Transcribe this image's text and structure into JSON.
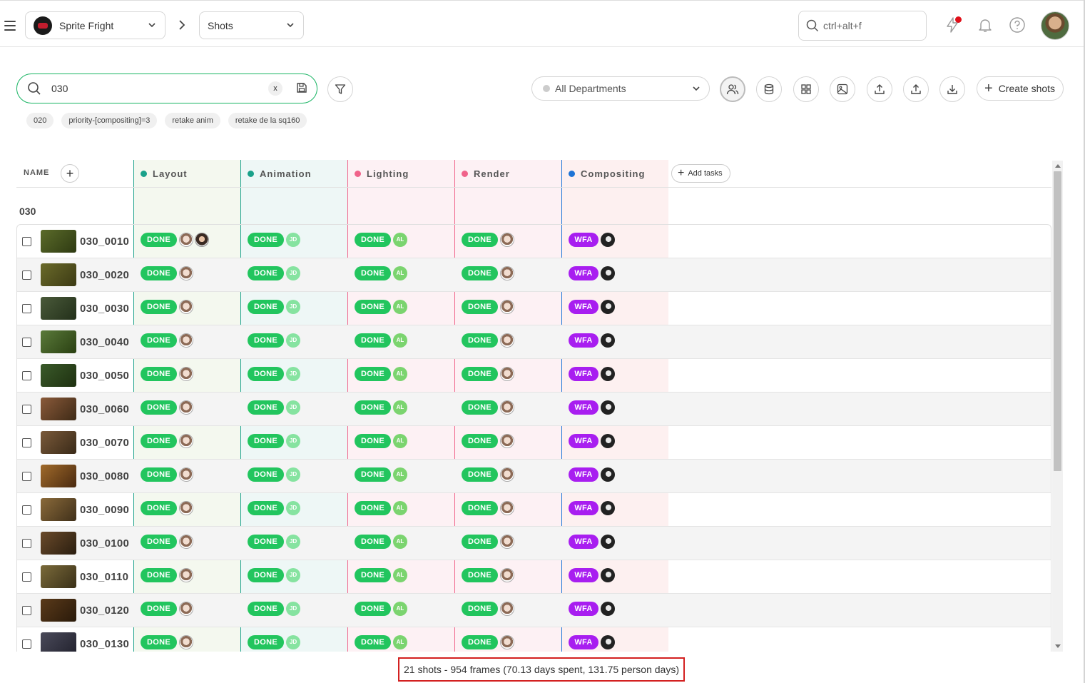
{
  "topbar": {
    "production": "Sprite Fright",
    "page": "Shots",
    "search_placeholder": "ctrl+alt+f"
  },
  "toolbar": {
    "search_value": "030",
    "clear_label": "x",
    "department": "All Departments",
    "create_label": "Create shots"
  },
  "chips": [
    "020",
    "priority-[compositing]=3",
    "retake anim",
    "retake de la sq160"
  ],
  "table": {
    "name_header": "NAME",
    "add_tasks_label": "Add tasks",
    "sequence": "030",
    "task_types": [
      {
        "name": "Layout",
        "color": "#1aa18a",
        "bg": "#f4f8ef"
      },
      {
        "name": "Animation",
        "color": "#1aa18a",
        "bg": "#eef7f6"
      },
      {
        "name": "Lighting",
        "color": "#f0638a",
        "bg": "#fdf1f4"
      },
      {
        "name": "Render",
        "color": "#f0638a",
        "bg": "#fdf1f4"
      },
      {
        "name": "Compositing",
        "color": "#1e74d6",
        "bg": "#fdf0f0"
      }
    ],
    "shots": [
      {
        "name": "030_0010",
        "layout": "DONE",
        "animation": "DONE",
        "lighting": "DONE",
        "render": "DONE",
        "compositing": "WFA"
      },
      {
        "name": "030_0020",
        "layout": "DONE",
        "animation": "DONE",
        "lighting": "DONE",
        "render": "DONE",
        "compositing": "WFA"
      },
      {
        "name": "030_0030",
        "layout": "DONE",
        "animation": "DONE",
        "lighting": "DONE",
        "render": "DONE",
        "compositing": "WFA"
      },
      {
        "name": "030_0040",
        "layout": "DONE",
        "animation": "DONE",
        "lighting": "DONE",
        "render": "DONE",
        "compositing": "WFA"
      },
      {
        "name": "030_0050",
        "layout": "DONE",
        "animation": "DONE",
        "lighting": "DONE",
        "render": "DONE",
        "compositing": "WFA"
      },
      {
        "name": "030_0060",
        "layout": "DONE",
        "animation": "DONE",
        "lighting": "DONE",
        "render": "DONE",
        "compositing": "WFA"
      },
      {
        "name": "030_0070",
        "layout": "DONE",
        "animation": "DONE",
        "lighting": "DONE",
        "render": "DONE",
        "compositing": "WFA"
      },
      {
        "name": "030_0080",
        "layout": "DONE",
        "animation": "DONE",
        "lighting": "DONE",
        "render": "DONE",
        "compositing": "WFA"
      },
      {
        "name": "030_0090",
        "layout": "DONE",
        "animation": "DONE",
        "lighting": "DONE",
        "render": "DONE",
        "compositing": "WFA"
      },
      {
        "name": "030_0100",
        "layout": "DONE",
        "animation": "DONE",
        "lighting": "DONE",
        "render": "DONE",
        "compositing": "WFA"
      },
      {
        "name": "030_0110",
        "layout": "DONE",
        "animation": "DONE",
        "lighting": "DONE",
        "render": "DONE",
        "compositing": "WFA"
      },
      {
        "name": "030_0120",
        "layout": "DONE",
        "animation": "DONE",
        "lighting": "DONE",
        "render": "DONE",
        "compositing": "WFA"
      },
      {
        "name": "030_0130",
        "layout": "DONE",
        "animation": "DONE",
        "lighting": "DONE",
        "render": "DONE",
        "compositing": "WFA"
      }
    ],
    "assignee_initials": {
      "animation": "JD",
      "lighting": "AL"
    }
  },
  "colors": {
    "accent": "#18b463",
    "done": "#22c55e",
    "wfa": "#a81ef0",
    "notification": "#e0101a"
  },
  "footer": {
    "stats": "21 shots - 954 frames (70.13 days spent, 131.75 person days)"
  }
}
